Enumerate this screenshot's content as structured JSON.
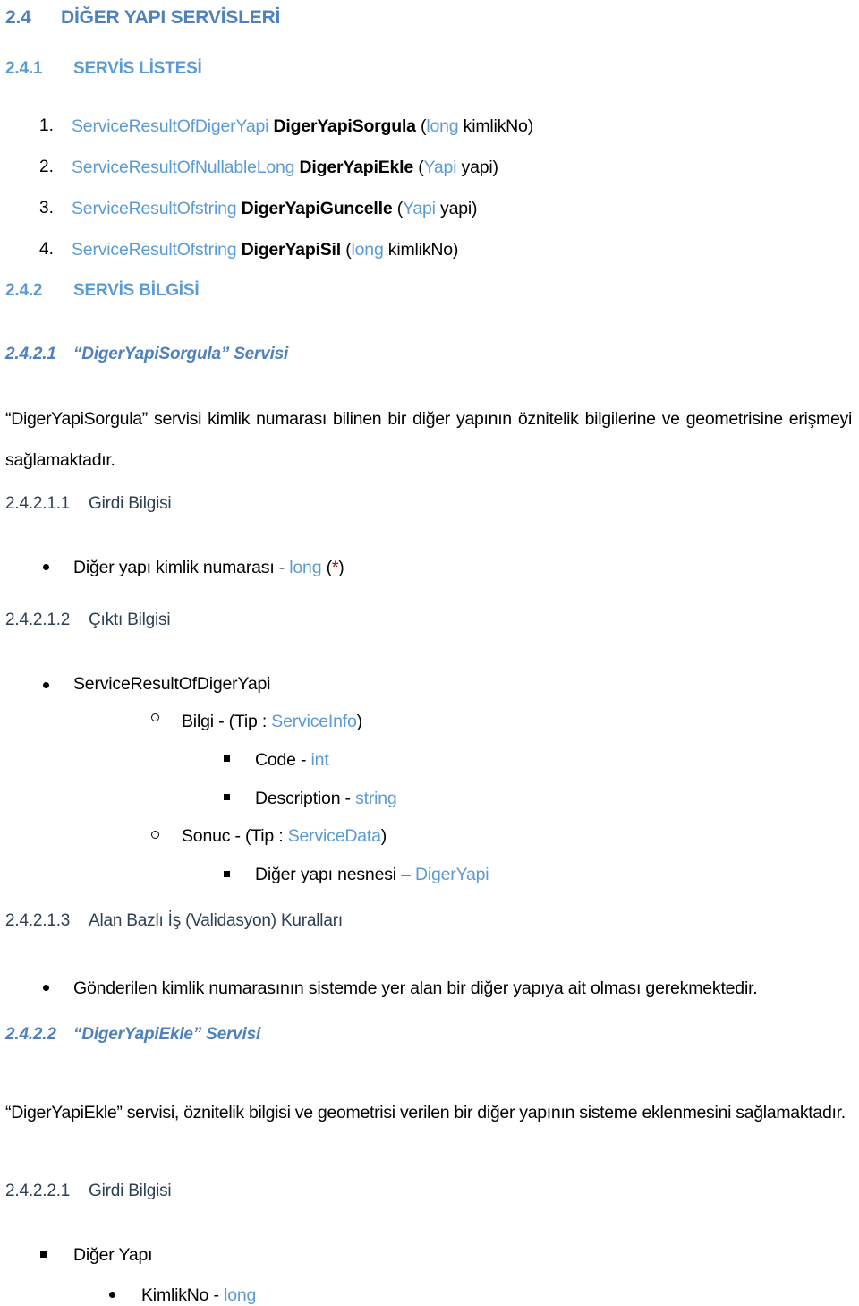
{
  "document": {
    "language": "tr",
    "colors": {
      "heading_primary": "#4E81BD",
      "heading_secondary": "#5B9BD5",
      "heading_minor": "#2E4053",
      "type_token": "#5B9BD5",
      "required_marker": "#C00000",
      "body_text": "#000000",
      "background": "#FFFFFF"
    }
  },
  "headings": {
    "h2_4": {
      "number": "2.4",
      "title": "DİĞER YAPI SERVİSLERİ"
    },
    "h2_4_1": {
      "number": "2.4.1",
      "title": "SERVİS LİSTESİ"
    },
    "h2_4_2": {
      "number": "2.4.2",
      "title": "SERVİS BİLGİSİ"
    },
    "h2_4_2_1": {
      "number": "2.4.2.1",
      "title": "“DigerYapiSorgula” Servisi"
    },
    "h2_4_2_1_1": {
      "number": "2.4.2.1.1",
      "title": "Girdi Bilgisi"
    },
    "h2_4_2_1_2": {
      "number": "2.4.2.1.2",
      "title": "Çıktı Bilgisi"
    },
    "h2_4_2_1_3": {
      "number": "2.4.2.1.3",
      "title": "Alan Bazlı İş (Validasyon) Kuralları"
    },
    "h2_4_2_2": {
      "number": "2.4.2.2",
      "title": "“DigerYapiEkle” Servisi"
    },
    "h2_4_2_2_1": {
      "number": "2.4.2.2.1",
      "title": "Girdi Bilgisi"
    }
  },
  "service_list": {
    "items": [
      {
        "number": "1.",
        "return_type": "ServiceResultOfDigerYapi",
        "method": "DigerYapiSorgula",
        "open_paren": "(",
        "param_type": "long",
        "param_name": " kimlikNo",
        "close_paren": ")"
      },
      {
        "number": "2.",
        "return_type": "ServiceResultOfNullableLong",
        "method": "DigerYapiEkle",
        "open_paren": "(",
        "param_type": "Yapi",
        "param_name": " yapi",
        "close_paren": ")"
      },
      {
        "number": "3.",
        "return_type": "ServiceResultOfstring",
        "method": "DigerYapiGuncelle",
        "open_paren": "(",
        "param_type": "Yapi",
        "param_name": " yapi",
        "close_paren": ")"
      },
      {
        "number": "4.",
        "return_type": "ServiceResultOfstring",
        "method": "DigerYapiSil",
        "open_paren": "(",
        "param_type": "long",
        "param_name": " kimlikNo",
        "close_paren": ")"
      }
    ]
  },
  "paragraphs": {
    "sorgula_description": "“DigerYapiSorgula” servisi kimlik numarası bilinen bir diğer yapının öznitelik bilgilerine ve geometrisine erişmeyi sağlamaktadır.",
    "ekle_description": "“DigerYapiEkle” servisi, öznitelik bilgisi ve geometrisi verilen bir diğer yapının sisteme eklenmesini sağlamaktadır."
  },
  "sorgula_input": {
    "bullet": "disc",
    "label": "Diğer yapı kimlik numarası - ",
    "type": "long",
    "space": " ",
    "paren_open": "(",
    "required": "*",
    "paren_close": ")"
  },
  "sorgula_output": {
    "root": {
      "bullet": "disc",
      "label": "ServiceResultOfDigerYapi"
    },
    "children": [
      {
        "bullet": "circle",
        "prefix": "Bilgi -  (Tip : ",
        "type": "ServiceInfo",
        "suffix": ")",
        "children": [
          {
            "bullet": "square",
            "prefix": "Code - ",
            "type": "int",
            "suffix": ""
          },
          {
            "bullet": "square",
            "prefix": "Description - ",
            "type": "string",
            "suffix": ""
          }
        ]
      },
      {
        "bullet": "circle",
        "prefix": "Sonuc -  (Tip : ",
        "type": "ServiceData",
        "suffix": ")",
        "children": [
          {
            "bullet": "square",
            "prefix": "Diğer yapı nesnesi – ",
            "type": "DigerYapi",
            "suffix": ""
          }
        ]
      }
    ]
  },
  "validation_rules": {
    "items": [
      {
        "bullet": "disc",
        "text": "Gönderilen kimlik numarasının sistemde yer alan bir diğer yapıya ait olması gerekmektedir."
      }
    ]
  },
  "ekle_input": {
    "root": {
      "bullet": "square",
      "label": "Diğer Yapı"
    },
    "children": [
      {
        "bullet": "disc",
        "prefix": "KimlikNo - ",
        "type": "long",
        "suffix": ""
      }
    ]
  }
}
